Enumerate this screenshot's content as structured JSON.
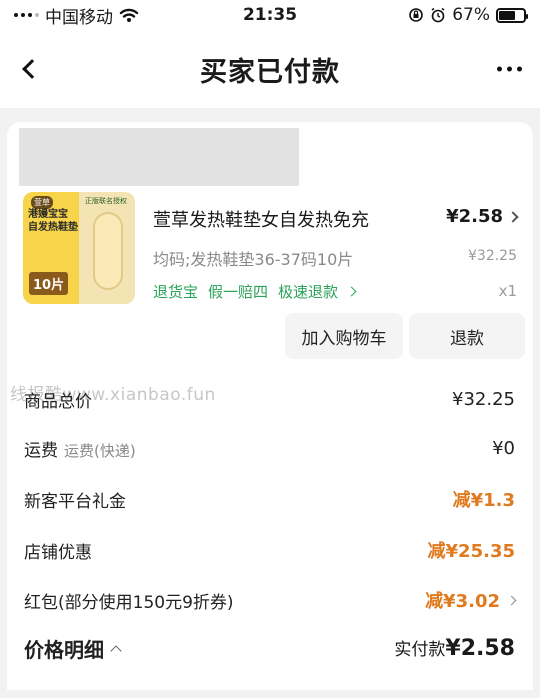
{
  "status": {
    "carrier": "中国移动",
    "time": "21:35",
    "battery_pct": "67%",
    "battery_level": 0.67
  },
  "nav": {
    "title": "买家已付款"
  },
  "order": {
    "product": {
      "title": "萱草发热鞋垫女自发热免充",
      "price": "¥2.58",
      "spec": "均码;发热鞋垫36-37码10片",
      "original_price": "¥32.25",
      "quantity": "x1",
      "services": [
        "退货宝",
        "假一赔四",
        "极速退款"
      ],
      "thumb": {
        "tag": "萱草",
        "line1": "港嫚宝宝",
        "line2": "自发热鞋垫",
        "count": "10片",
        "brand": "正版联名授权"
      }
    },
    "buttons": {
      "add_to_cart": "加入购物车",
      "refund": "退款"
    }
  },
  "watermark": "线报酷www.xianbao.fun",
  "pricing": {
    "rows": [
      {
        "label": "商品总价",
        "value": "¥32.25"
      },
      {
        "label": "运费",
        "sub": "运费(快递)",
        "value": "¥0"
      },
      {
        "label": "新客平台礼金",
        "value": "减¥1.3"
      },
      {
        "label": "店铺优惠",
        "value": "减¥25.35"
      },
      {
        "label": "红包(部分使用150元9折券)",
        "value": "减¥3.02"
      }
    ],
    "detail_label": "价格明细",
    "paid_label": "实付款",
    "paid_amount": "¥2.58"
  },
  "colors": {
    "discount": "#e07a1f",
    "service_green": "#2ba35a",
    "background": "#f2f2f2"
  }
}
